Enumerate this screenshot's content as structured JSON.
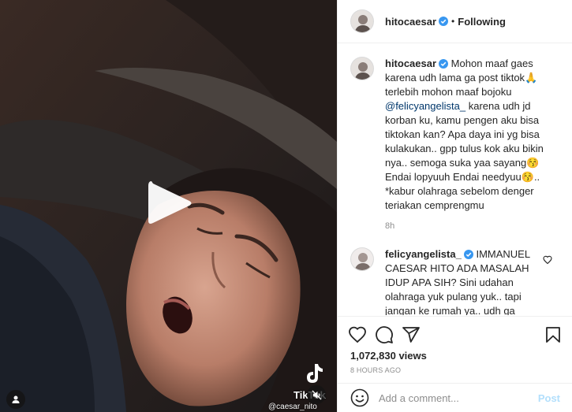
{
  "post": {
    "username": "hitocaesar",
    "follow_separator": "•",
    "follow_status": "Following"
  },
  "caption": {
    "username": "hitocaesar",
    "text_before_mention": "Mohon maaf gaes karena udh lama ga post tiktok🙏 terlebih mohon maaf bojoku",
    "mention": "@felicyangelista_",
    "text_after_mention": "karena udh jd korban ku, kamu pengen aku bisa tiktokan kan? Apa daya ini yg bisa kulakukan.. gpp tulus kok aku bikin nya.. semoga suka yaa sayang😚 Endai lopyuuh Endai needyuu😚.. *kabur olahraga sebelom denger teriakan cemprengmu",
    "time": "8h"
  },
  "comments": [
    {
      "username": "felicyangelista_",
      "text": "IMMANUEL CAESAR HITO ADA MASALAH IDUP APA SIH? Sini udahan olahraga yuk pulang yuk.. tapi jangan ke rumah ya.. udh ga diterima lagi 🙃"
    }
  ],
  "media": {
    "tiktok_label": "TikTok",
    "watermark_handle": "@caesar_nito"
  },
  "stats": {
    "views": "1,072,830 views",
    "posted": "8 HOURS AGO"
  },
  "composer": {
    "placeholder": "Add a comment...",
    "post_label": "Post"
  },
  "colors": {
    "verified": "#3897f0",
    "link": "#00376b",
    "post_disabled": "#b2dffc",
    "muted": "#8e8e8e"
  },
  "icons": [
    "play-icon",
    "verified-icon",
    "heart-icon",
    "comment-icon",
    "share-icon",
    "bookmark-icon",
    "emoji-icon",
    "mute-icon",
    "user-tag-icon",
    "tiktok-logo-icon"
  ]
}
